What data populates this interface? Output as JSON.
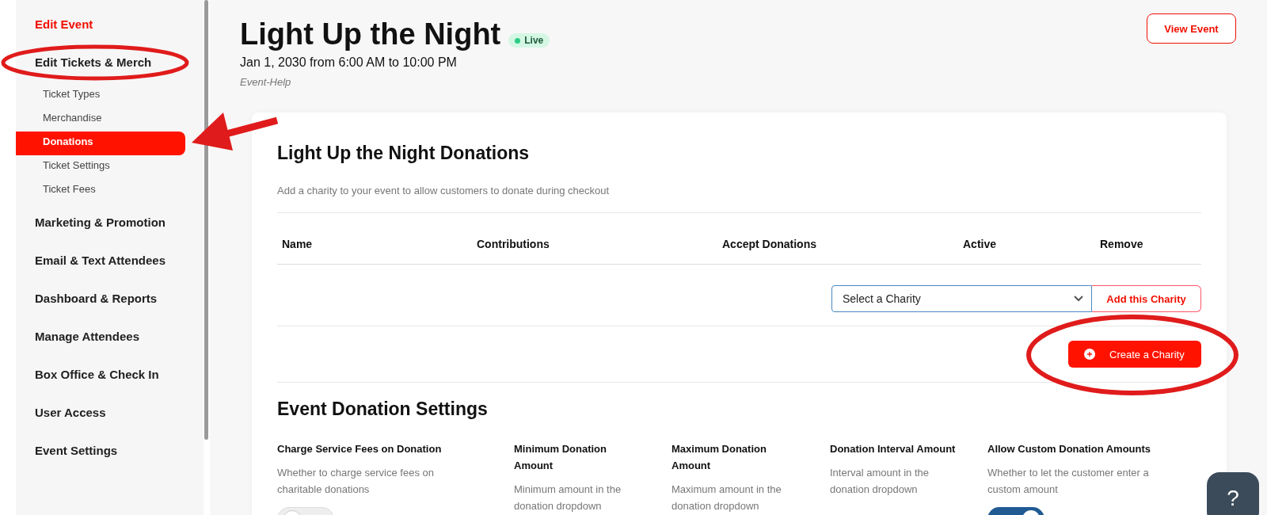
{
  "sidebar": {
    "items": [
      {
        "label": "Edit Event",
        "selected": true
      },
      {
        "label": "Edit Tickets & Merch",
        "selected": false,
        "children": [
          {
            "label": "Ticket Types",
            "selected": false
          },
          {
            "label": "Merchandise",
            "selected": false
          },
          {
            "label": "Donations",
            "selected": true
          },
          {
            "label": "Ticket Settings",
            "selected": false
          },
          {
            "label": "Ticket Fees",
            "selected": false
          }
        ]
      },
      {
        "label": "Marketing & Promotion",
        "selected": false
      },
      {
        "label": "Email & Text Attendees",
        "selected": false
      },
      {
        "label": "Dashboard & Reports",
        "selected": false
      },
      {
        "label": "Manage Attendees",
        "selected": false
      },
      {
        "label": "Box Office & Check In",
        "selected": false
      },
      {
        "label": "User Access",
        "selected": false
      },
      {
        "label": "Event Settings",
        "selected": false
      }
    ]
  },
  "event": {
    "title": "Light Up the Night",
    "status": "Live",
    "date": "Jan 1, 2030 from 6:00 AM to 10:00 PM",
    "subtitle": "Event-Help",
    "view_button": "View Event"
  },
  "donations": {
    "title": "Light Up the Night Donations",
    "description": "Add a charity to your event to allow customers to donate during checkout",
    "table": {
      "columns": [
        "Name",
        "Contributions",
        "Accept Donations",
        "Active",
        "Remove"
      ]
    },
    "charity_select": {
      "value": "Select a Charity"
    },
    "add_button": "Add this Charity",
    "create_button": "Create a Charity"
  },
  "settings": {
    "title": "Event Donation Settings",
    "items": [
      {
        "kind": "toggle",
        "title": "Charge Service Fees on Donation",
        "description": "Whether to charge service fees on charitable donations",
        "on": false
      },
      {
        "kind": "amount",
        "title": "Minimum Donation Amount",
        "description": "Minimum amount in the donation dropdown"
      },
      {
        "kind": "amount",
        "title": "Maximum Donation Amount",
        "description": "Maximum amount in the donation dropdown"
      },
      {
        "kind": "amount",
        "title": "Donation Interval Amount",
        "description": "Interval amount in the donation dropdown"
      },
      {
        "kind": "toggle",
        "title": "Allow Custom Donation Amounts",
        "description": "Whether to let the customer enter a custom amount",
        "on": true
      }
    ]
  },
  "help_button": "?"
}
